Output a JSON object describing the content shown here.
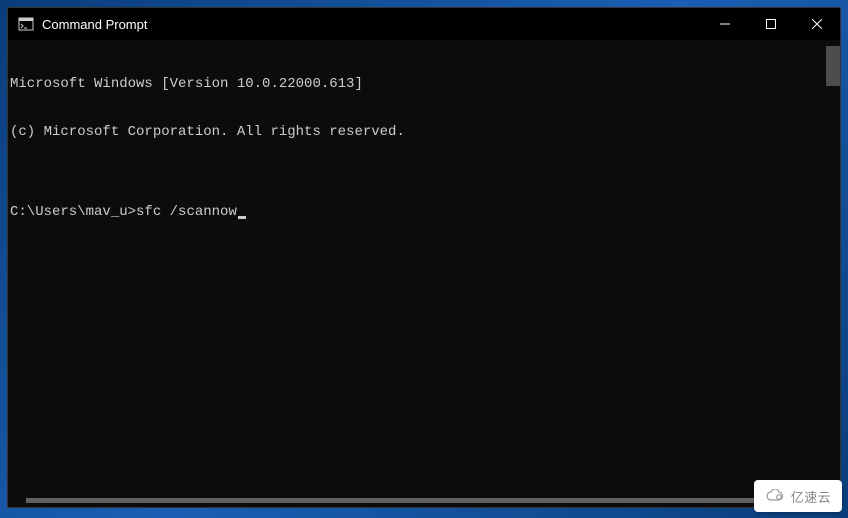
{
  "window": {
    "title": "Command Prompt"
  },
  "terminal": {
    "line1": "Microsoft Windows [Version 10.0.22000.613]",
    "line2": "(c) Microsoft Corporation. All rights reserved.",
    "blank": "",
    "prompt": "C:\\Users\\mav_u>",
    "command": "sfc /scannow"
  },
  "watermark": {
    "text": "亿速云"
  }
}
